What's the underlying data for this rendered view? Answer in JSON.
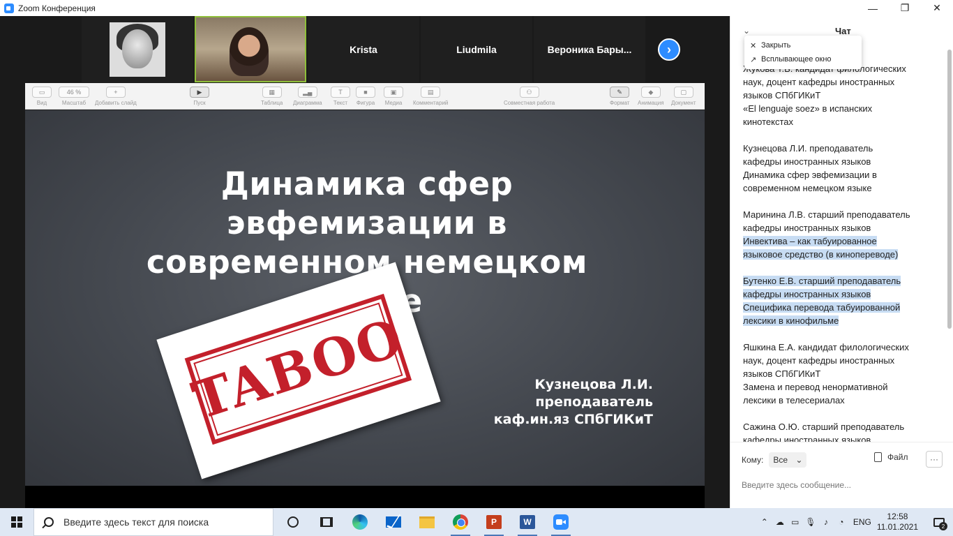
{
  "window": {
    "title": "Zoom Конференция",
    "minimize": "—",
    "maximize": "❐",
    "close": "✕"
  },
  "participants": [
    {
      "name": ""
    },
    {
      "name": ""
    },
    {
      "name": "Krista"
    },
    {
      "name": "Liudmila"
    },
    {
      "name": "Вероника  Бары..."
    }
  ],
  "next_glyph": "›",
  "keynote": {
    "toolbar": [
      {
        "icon": "▭",
        "label": "Вид"
      },
      {
        "icon": "46 %",
        "label": "Масштаб"
      },
      {
        "icon": "+",
        "label": "Добавить слайд"
      },
      {
        "icon": "▶",
        "label": "Пуск"
      },
      {
        "icon": "▦",
        "label": "Таблица"
      },
      {
        "icon": "▂▄",
        "label": "Диаграмма"
      },
      {
        "icon": "T",
        "label": "Текст"
      },
      {
        "icon": "■",
        "label": "Фигура"
      },
      {
        "icon": "▣",
        "label": "Медиа"
      },
      {
        "icon": "▤",
        "label": "Комментарий"
      },
      {
        "icon": "⚇",
        "label": "Совместная работа"
      },
      {
        "icon": "✎",
        "label": "Формат"
      },
      {
        "icon": "◆",
        "label": "Анимация"
      },
      {
        "icon": "▢",
        "label": "Документ"
      }
    ]
  },
  "slide": {
    "title_line1": "Динамика сфер эвфемизации в",
    "title_line2": "современном немецком языке",
    "stamp": "TABOO",
    "author_line1": "Кузнецова Л.И.",
    "author_line2": "преподаватель",
    "author_line3": "каф.ин.яз СПбГИКиТ"
  },
  "chat": {
    "title": "Чат",
    "popup": {
      "close": "Закрыть",
      "popout": "Всплывающее окно"
    },
    "messages": [
      {
        "lines": [
          "Жукова Т.В. кандидат филологических",
          "наук, доцент кафедры иностранных",
          "языков СПбГИКиТ",
          "«El lenguaje soez» в испанских",
          "кинотекстах"
        ]
      },
      {
        "lines": [
          "Кузнецова Л.И. преподаватель",
          "кафедры иностранных языков",
          "Динамика сфер эвфемизации в",
          "современном немецком языке"
        ]
      },
      {
        "lines": [
          "Маринина Л.В. старший преподаватель",
          "кафедры иностранных языков",
          "Инвектива – как табуированное",
          "языковое средство (в кинопереводе)"
        ]
      },
      {
        "lines": [
          "Бутенко Е.В. старший преподаватель",
          "кафедры иностранных языков",
          "Специфика перевода табуированной",
          "лексики в кинофильме"
        ]
      },
      {
        "lines": [
          "Яшкина Е.А. кандидат филологических",
          "наук, доцент кафедры иностранных",
          "языков СПбГИКиТ",
          "Замена и перевод ненормативной",
          "лексики в телесериалах"
        ]
      },
      {
        "lines": [
          "Сажина О.Ю. старший преподаватель",
          "кафедры иностранных языков"
        ]
      }
    ],
    "to_label": "Кому:",
    "to_value": "Все",
    "file_label": "Файл",
    "more": "···",
    "input_placeholder": "Введите здесь сообщение..."
  },
  "taskbar": {
    "search_placeholder": "Введите здесь текст для поиска",
    "lang": "ENG",
    "time": "12:58",
    "date": "11.01.2021",
    "notifications": "2",
    "ppt": "P",
    "word": "W"
  }
}
